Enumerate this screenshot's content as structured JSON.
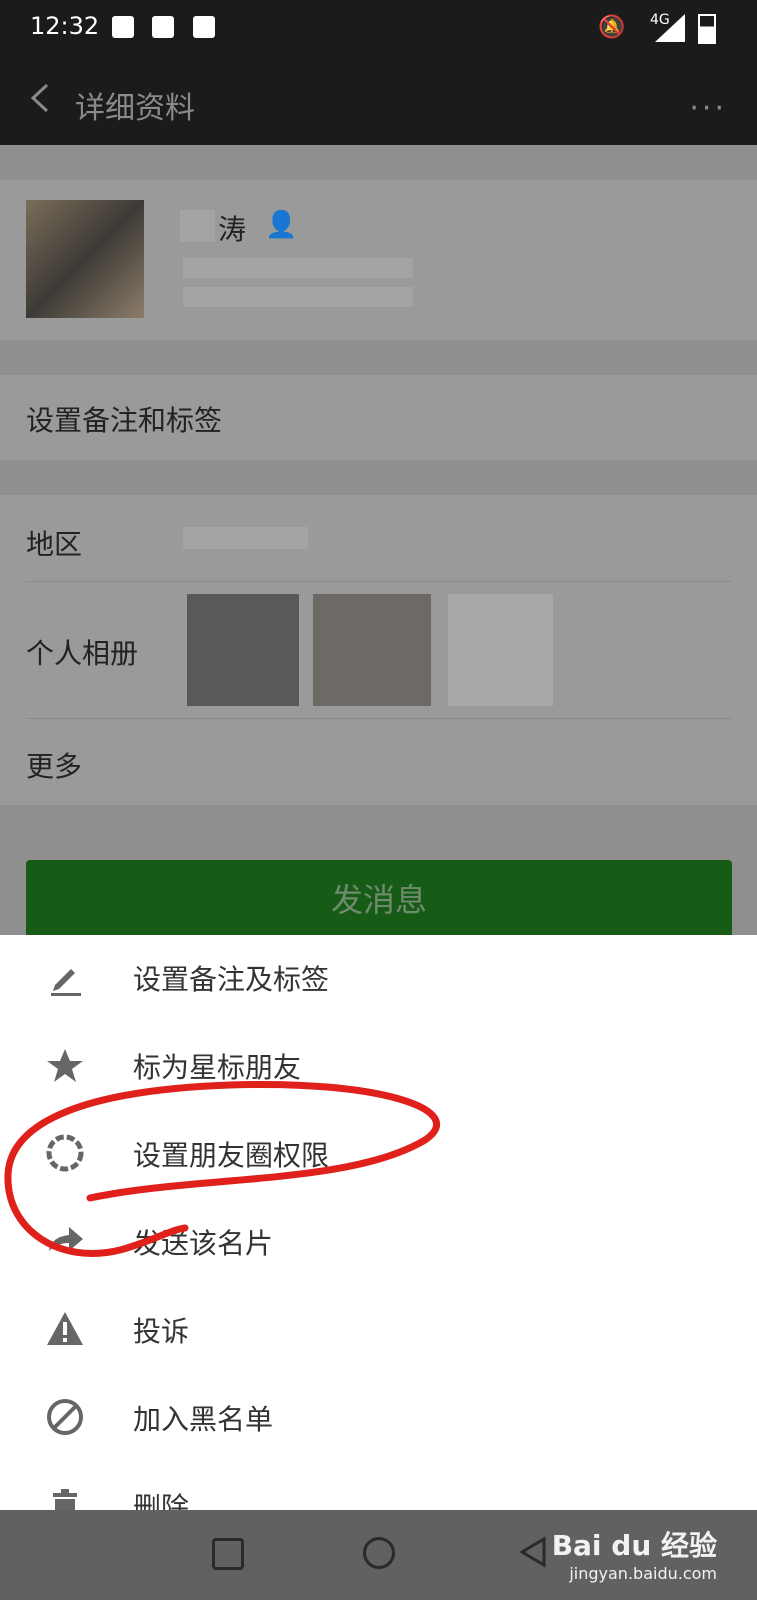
{
  "status_bar": {
    "time": "12:32",
    "network": "4G"
  },
  "app_bar": {
    "title": "详细资料",
    "more": "···"
  },
  "profile": {
    "name_suffix": "涛"
  },
  "rows": {
    "remark": "设置备注和标签",
    "region": "地区",
    "album": "个人相册",
    "more": "更多"
  },
  "send_button": "发消息",
  "menu": [
    {
      "label": "设置备注及标签",
      "icon": "edit-icon"
    },
    {
      "label": "标为星标朋友",
      "icon": "star-icon"
    },
    {
      "label": "设置朋友圈权限",
      "icon": "camera-aperture-icon"
    },
    {
      "label": "发送该名片",
      "icon": "share-icon"
    },
    {
      "label": "投诉",
      "icon": "warning-icon"
    },
    {
      "label": "加入黑名单",
      "icon": "block-icon"
    },
    {
      "label": "删除",
      "icon": "trash-icon"
    }
  ],
  "watermark": {
    "brand": "Bai du 经验",
    "site": "jingyan.baidu.com"
  },
  "annotation_color": "#e0201b"
}
